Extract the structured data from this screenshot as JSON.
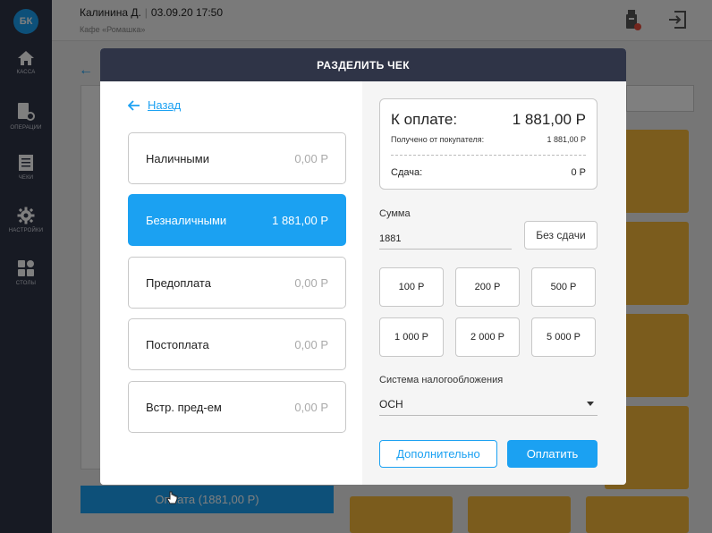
{
  "sidebar": {
    "logo": "БК",
    "items": [
      {
        "label": "КАССА",
        "icon": "home-icon"
      },
      {
        "label": "ОПЕРАЦИИ",
        "icon": "operations-icon"
      },
      {
        "label": "ЧЕКИ",
        "icon": "receipt-icon"
      },
      {
        "label": "НАСТРОЙКИ",
        "icon": "gear-icon"
      },
      {
        "label": "СТОЛЫ",
        "icon": "tables-icon"
      }
    ]
  },
  "topbar": {
    "user": "Калинина Д.",
    "datetime": "03.09.20 17:50",
    "place": "Кафе «Ромашка»"
  },
  "background": {
    "pay_button": "Оплата (1881,00 Р)"
  },
  "modal": {
    "title": "РАЗДЕЛИТЬ ЧЕК",
    "back_label": "Назад",
    "payment_methods": [
      {
        "label": "Наличными",
        "amount": "0,00 Р",
        "active": false
      },
      {
        "label": "Безналичными",
        "amount": "1 881,00 Р",
        "active": true
      },
      {
        "label": "Предоплата",
        "amount": "0,00 Р",
        "active": false
      },
      {
        "label": "Постоплата",
        "amount": "0,00 Р",
        "active": false
      },
      {
        "label": "Встр. пред-ем",
        "amount": "0,00 Р",
        "active": false
      }
    ],
    "summary": {
      "to_pay_label": "К оплате:",
      "to_pay_value": "1 881,00 Р",
      "received_label": "Получено от покупателя:",
      "received_value": "1 881,00 Р",
      "change_label": "Сдача:",
      "change_value": "0 Р"
    },
    "sum_label": "Сумма",
    "sum_value": "1881",
    "no_change_button": "Без сдачи",
    "quick_amounts": [
      "100 Р",
      "200 Р",
      "500 Р",
      "1 000 Р",
      "2 000 Р",
      "5 000 Р"
    ],
    "tax_label": "Система налогообложения",
    "tax_value": "ОСН",
    "more_button": "Дополнительно",
    "pay_button": "Оплатить"
  },
  "colors": {
    "accent": "#1ba1f2",
    "sidebar": "#2f3447",
    "tile": "#f6b93b"
  }
}
